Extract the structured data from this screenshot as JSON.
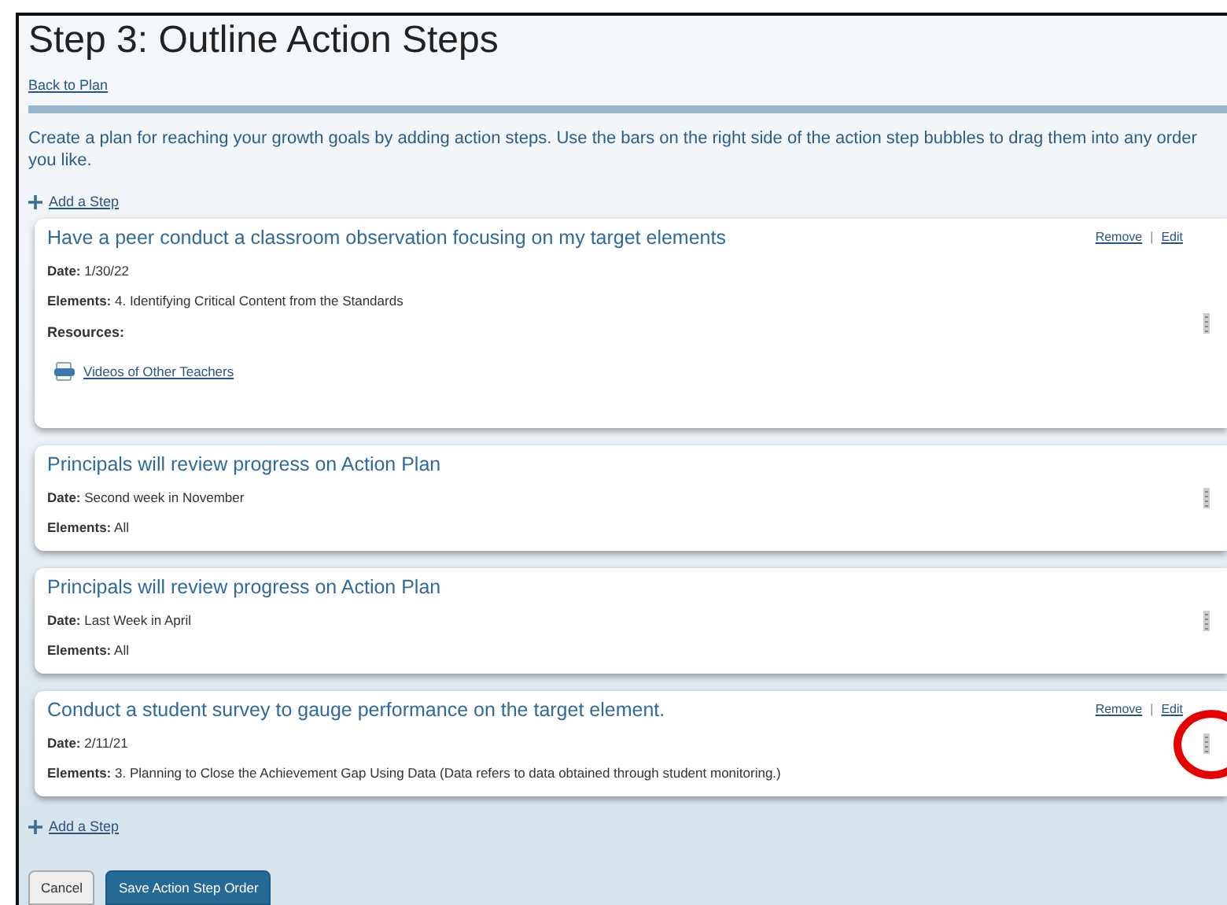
{
  "title": "Step 3: Outline Action Steps",
  "back_link": "Back to Plan",
  "instructions": "Create a plan for reaching your growth goals by adding action steps. Use the bars on the right side of the action step bubbles to drag them into any order you like.",
  "add_step_top": "Add a Step",
  "steps": [
    {
      "title": "Have a peer conduct a classroom observation focusing on my target elements",
      "actions": [
        "Remove",
        "Edit"
      ],
      "action_separator": "|",
      "fields": [
        {
          "label": "Date:",
          "value": "1/30/22"
        },
        {
          "label": "Elements:",
          "value": "4. Identifying Critical Content from the Standards"
        }
      ],
      "resources_label": "Resources:",
      "resources": [
        "Videos of Other Teachers"
      ],
      "highlighted": false
    },
    {
      "title": "Principals will review progress on Action Plan",
      "fields": [
        {
          "label": "Date:",
          "value": "Second week in November"
        },
        {
          "label": "Elements:",
          "value": "All"
        }
      ],
      "highlighted": false
    },
    {
      "title": "Principals will review progress on Action Plan",
      "fields": [
        {
          "label": "Date:",
          "value": "Last Week in April"
        },
        {
          "label": "Elements:",
          "value": "All"
        }
      ],
      "highlighted": false
    },
    {
      "title": "Conduct a student survey to gauge performance on the target element.",
      "actions": [
        "Remove",
        "Edit"
      ],
      "action_separator": "|",
      "fields": [
        {
          "label": "Date:",
          "value": "2/11/21"
        },
        {
          "label": "Elements:",
          "value": "3. Planning to Close the Achievement Gap Using Data (Data refers to data obtained through student monitoring.)"
        }
      ],
      "highlighted": true
    }
  ],
  "add_step_bottom": "Add a Step",
  "buttons": [
    {
      "label": "Cancel",
      "kind": "secondary"
    },
    {
      "label": "Save Action Step Order",
      "kind": "primary"
    }
  ]
}
